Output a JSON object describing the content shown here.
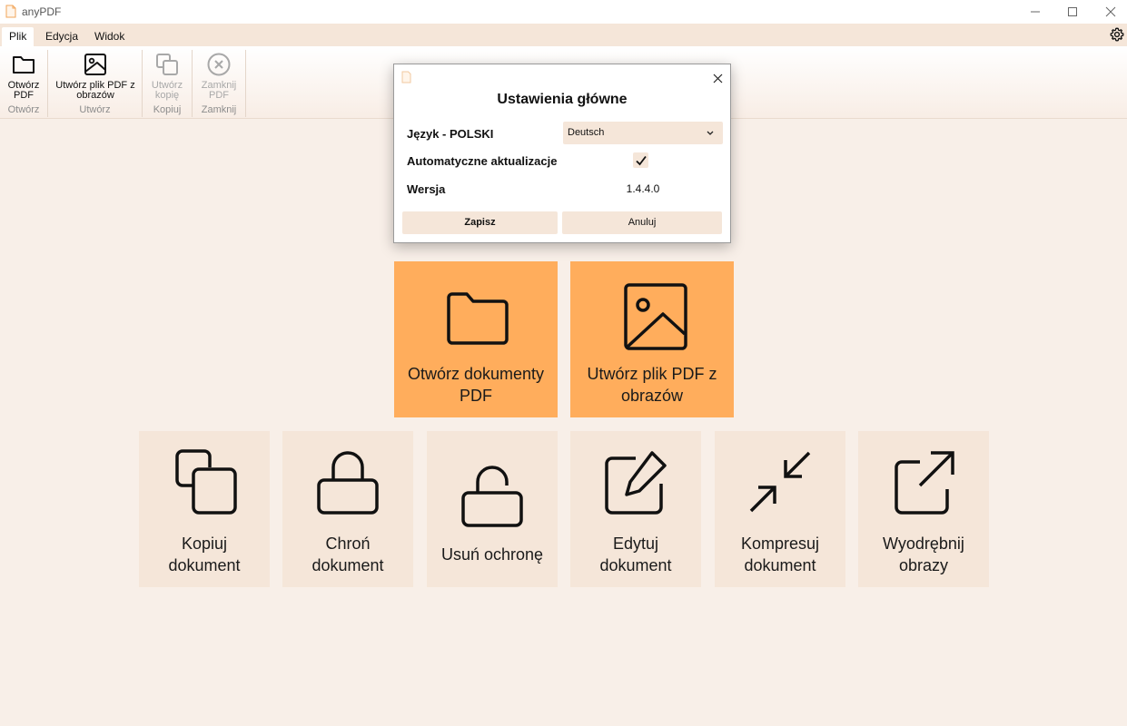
{
  "window": {
    "title": "anyPDF"
  },
  "tabs": [
    {
      "label": "Plik"
    },
    {
      "label": "Edycja"
    },
    {
      "label": "Widok"
    }
  ],
  "ribbon": {
    "groups": [
      {
        "label": "Otwórz",
        "button": "Otwórz\nPDF",
        "disabled": false
      },
      {
        "label": "Utwórz",
        "button": "Utwórz plik PDF z\nobrazów",
        "disabled": false
      },
      {
        "label": "Kopiuj",
        "button": "Utwórz\nkopię",
        "disabled": true
      },
      {
        "label": "Zamknij",
        "button": "Zamknij\nPDF",
        "disabled": true
      }
    ]
  },
  "tiles": {
    "open": "Otwórz dokumenty PDF",
    "create": "Utwórz plik PDF z obrazów",
    "copy": "Kopiuj dokument",
    "protect": "Chroń dokument",
    "unprotect": "Usuń ochronę",
    "edit": "Edytuj dokument",
    "compress": "Kompresuj dokument",
    "extract": "Wyodrębnij obrazy"
  },
  "dialog": {
    "title": "Ustawienia główne",
    "language_label": "Język - POLSKI",
    "language_value": "Deutsch",
    "auto_update_label": "Automatyczne aktualizacje",
    "auto_update_checked": true,
    "version_label": "Wersja",
    "version_value": "1.4.4.0",
    "save_label": "Zapisz",
    "cancel_label": "Anuluj"
  },
  "colors": {
    "accent": "#ffad5c",
    "tile": "#f5e6d9",
    "background": "#f8efe8"
  }
}
